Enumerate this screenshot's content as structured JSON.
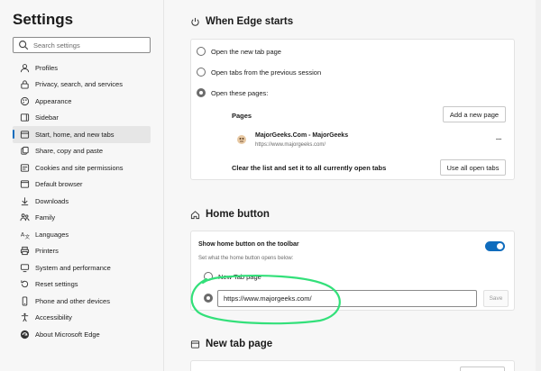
{
  "sidebar": {
    "title": "Settings",
    "search_placeholder": "Search settings",
    "items": [
      {
        "label": "Profiles",
        "icon": "profile-icon"
      },
      {
        "label": "Privacy, search, and services",
        "icon": "lock-icon"
      },
      {
        "label": "Appearance",
        "icon": "appearance-icon"
      },
      {
        "label": "Sidebar",
        "icon": "sidebar-icon"
      },
      {
        "label": "Start, home, and new tabs",
        "icon": "start-home-icon",
        "active": true
      },
      {
        "label": "Share, copy and paste",
        "icon": "share-icon"
      },
      {
        "label": "Cookies and site permissions",
        "icon": "cookies-icon"
      },
      {
        "label": "Default browser",
        "icon": "default-browser-icon"
      },
      {
        "label": "Downloads",
        "icon": "download-icon"
      },
      {
        "label": "Family",
        "icon": "family-icon"
      },
      {
        "label": "Languages",
        "icon": "languages-icon"
      },
      {
        "label": "Printers",
        "icon": "printer-icon"
      },
      {
        "label": "System and performance",
        "icon": "system-icon"
      },
      {
        "label": "Reset settings",
        "icon": "reset-icon"
      },
      {
        "label": "Phone and other devices",
        "icon": "phone-icon"
      },
      {
        "label": "Accessibility",
        "icon": "accessibility-icon"
      },
      {
        "label": "About Microsoft Edge",
        "icon": "edge-logo-icon"
      }
    ]
  },
  "startup": {
    "title": "When Edge starts",
    "options": [
      "Open the new tab page",
      "Open tabs from the previous session",
      "Open these pages:"
    ],
    "selected_index": 2,
    "pages_label": "Pages",
    "add_button": "Add a new page",
    "page": {
      "title": "MajorGeeks.Com - MajorGeeks",
      "url": "https://www.majorgeeks.com/"
    },
    "more_label": "...",
    "clear_label": "Clear the list and set it to all currently open tabs",
    "use_all_button": "Use all open tabs"
  },
  "home": {
    "title": "Home button",
    "toggle_label": "Show home button on the toolbar",
    "toggle_on": true,
    "subtitle": "Set what the home button opens below:",
    "options": [
      "New Tab page"
    ],
    "url_value": "https://www.majorgeeks.com/",
    "save_button": "Save"
  },
  "newtab": {
    "title": "New tab page"
  },
  "colors": {
    "accent": "#0f6cbd",
    "annotation": "#33e07a"
  }
}
